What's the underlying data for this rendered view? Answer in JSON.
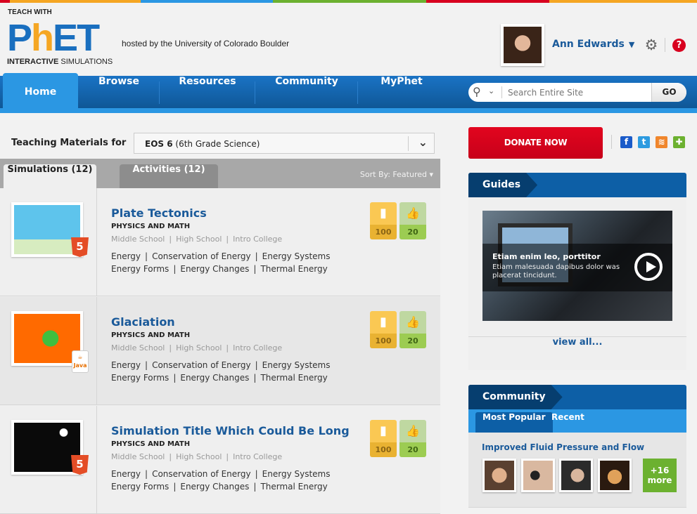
{
  "header": {
    "logo": {
      "teach_with": "TEACH WITH",
      "ph": "PH",
      "e": "E",
      "t": "T",
      "interactive": "INTERACTIVE",
      "simulations": "SIMULATIONS"
    },
    "hosted_by": "hosted by the University of Colorado Boulder",
    "user": {
      "name": "Ann Edwards",
      "caret": "▼"
    },
    "icons": {
      "settings": "⚙",
      "help": "?"
    },
    "stripe_colors": [
      "#d8001f",
      "#f5a623",
      "#2b97e3",
      "#6cb130"
    ]
  },
  "nav": {
    "items": [
      {
        "label": "Home",
        "active": true
      },
      {
        "label": "Browse"
      },
      {
        "label": "Resources"
      },
      {
        "label": "Community"
      },
      {
        "label": "MyPhet"
      }
    ],
    "search": {
      "placeholder": "Search Entire Site",
      "go": "GO"
    }
  },
  "teaching": {
    "label": "Teaching Materials for",
    "selected_code": "EOS 6",
    "selected_desc": " (6th Grade Science)"
  },
  "tabs": [
    {
      "label": "Simulations (12)",
      "active": true
    },
    {
      "label": "Activities (12)"
    }
  ],
  "sort_by": "Sort By: Featured ▾",
  "simulations": [
    {
      "title": "Plate Tectonics",
      "category": "PHYSICS AND MATH",
      "levels": [
        "Middle School",
        "High School",
        "Intro College"
      ],
      "topics_line1": [
        "Energy",
        "Conservation of Energy",
        "Energy Systems"
      ],
      "topics_line2": [
        "Energy Forms",
        "Energy Changes",
        "Thermal Energy"
      ],
      "platform": "html5",
      "favorites": "100",
      "likes": "20"
    },
    {
      "title": "Glaciation",
      "category": "PHYSICS AND MATH",
      "levels": [
        "Middle School",
        "High School",
        "Intro College"
      ],
      "topics_line1": [
        "Energy",
        "Conservation of Energy",
        "Energy Systems"
      ],
      "topics_line2": [
        "Energy Forms",
        "Energy Changes",
        "Thermal Energy"
      ],
      "platform": "java",
      "favorites": "100",
      "likes": "20"
    },
    {
      "title": "Simulation Title Which Could Be Long",
      "category": "PHYSICS AND MATH",
      "levels": [
        "Middle School",
        "High School",
        "Intro College"
      ],
      "topics_line1": [
        "Energy",
        "Conservation of Energy",
        "Energy Systems"
      ],
      "topics_line2": [
        "Energy Forms",
        "Energy Changes",
        "Thermal Energy"
      ],
      "platform": "html5",
      "favorites": "100",
      "likes": "20"
    }
  ],
  "badges": {
    "html5": "5",
    "java": "Java"
  },
  "sidebar": {
    "donate": "DONATE NOW",
    "social": [
      {
        "name": "facebook",
        "glyph": "f",
        "color": "#1a5bc9"
      },
      {
        "name": "twitter",
        "glyph": "t",
        "color": "#2d9be0"
      },
      {
        "name": "rss",
        "glyph": "≋",
        "color": "#f0862c"
      },
      {
        "name": "share",
        "glyph": "✚",
        "color": "#6cb130"
      }
    ],
    "guides": {
      "title": "Guides",
      "video_title": "Etiam enim leo, porttitor",
      "video_desc": "Etiam malesuada dapibus dolor was placerat tincidunt.",
      "view_all": "view all..."
    },
    "community": {
      "title": "Community",
      "tabs": [
        {
          "label": "Most Popular",
          "active": true
        },
        {
          "label": "Recent"
        }
      ],
      "item_title": "Improved Fluid Pressure and Flow",
      "more_count": "+16",
      "more_label": "more"
    }
  }
}
